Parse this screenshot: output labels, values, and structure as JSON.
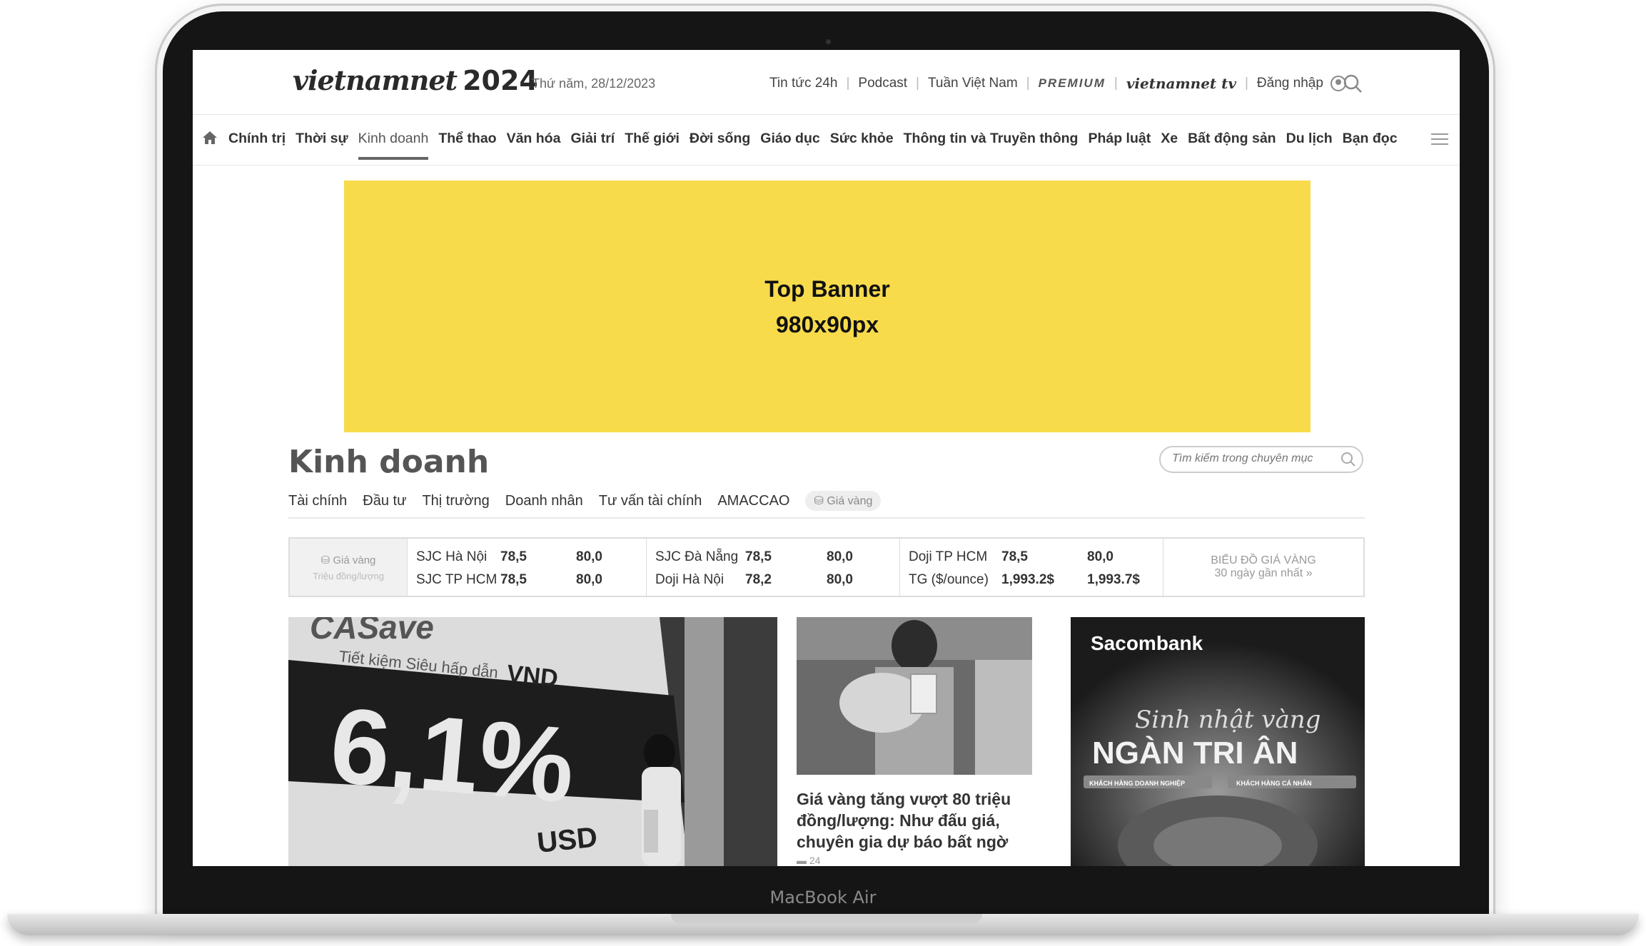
{
  "device": {
    "label": "MacBook Air"
  },
  "header": {
    "logo_text": "vietnamnet",
    "logo_year": "2024",
    "date": "Thứ năm, 28/12/2023",
    "links": [
      "Tin tức 24h",
      "Podcast",
      "Tuần Việt Nam"
    ],
    "premium": "PREMIUM",
    "tv_logo": "vietnamnet tv",
    "login": "Đăng nhập"
  },
  "nav": {
    "items": [
      "Chính trị",
      "Thời sự",
      "Kinh doanh",
      "Thể thao",
      "Văn hóa",
      "Giải trí",
      "Thế giới",
      "Đời sống",
      "Giáo dục",
      "Sức khỏe",
      "Thông tin và Truyền thông",
      "Pháp luật",
      "Xe",
      "Bất động sản",
      "Du lịch",
      "Bạn đọc"
    ],
    "active": "Kinh doanh"
  },
  "banner": {
    "line1": "Top Banner",
    "line2": "980x90px"
  },
  "section": {
    "title": "Kinh doanh",
    "search_placeholder": "Tìm kiếm trong chuyên mục",
    "subnav": [
      "Tài chính",
      "Đầu tư",
      "Thị trường",
      "Doanh nhân",
      "Tư vấn tài chính",
      "AMACCAO"
    ],
    "gold_pill": "Giá vàng"
  },
  "gold": {
    "head": "Giá vàng",
    "unit": "Triệu đồng/lượng",
    "col1": [
      {
        "name": "SJC Hà Nội",
        "buy": "78,5",
        "sell": "80,0"
      },
      {
        "name": "SJC TP HCM",
        "buy": "78,5",
        "sell": "80,0"
      }
    ],
    "col2": [
      {
        "name": "SJC Đà Nẵng",
        "buy": "78,5",
        "sell": "80,0"
      },
      {
        "name": "Doji Hà Nội",
        "buy": "78,2",
        "sell": "80,0"
      }
    ],
    "col3": [
      {
        "name": "Doji TP HCM",
        "buy": "78,5",
        "sell": "80,0"
      },
      {
        "name": "TG ($/ounce)",
        "buy": "1,993.2$",
        "sell": "1,993.7$"
      }
    ],
    "chart_title": "BIỂU ĐỒ GIÁ VÀNG",
    "chart_sub": "30 ngày gần nhất »"
  },
  "featured": {
    "img1_text": {
      "brand": "CASave",
      "sub": "Tiết kiệm Siêu hấp dẫn",
      "currency": "VND",
      "rate": "6,1%",
      "usd": "USD"
    },
    "article_title": "Giá vàng tăng vượt 80 triệu đồng/lượng: Như đấu giá, chuyên gia dự báo bất ngờ",
    "comments": "24",
    "ad": {
      "brand": "Sacombank",
      "script": "Sinh nhật vàng",
      "headline": "NGÀN TRI ÂN",
      "tag1": "KHÁCH HÀNG DOANH NGHIỆP",
      "tag2": "KHÁCH HÀNG CÁ NHÂN"
    }
  }
}
